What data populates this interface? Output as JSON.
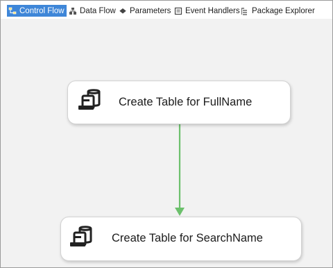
{
  "tabs": [
    {
      "label": "Control Flow",
      "icon": "control-flow-icon",
      "active": true
    },
    {
      "label": "Data Flow",
      "icon": "data-flow-icon",
      "active": false
    },
    {
      "label": "Parameters",
      "icon": "parameters-icon",
      "active": false
    },
    {
      "label": "Event Handlers",
      "icon": "event-handlers-icon",
      "active": false
    },
    {
      "label": "Package Explorer",
      "icon": "package-explorer-icon",
      "active": false
    }
  ],
  "tasks": [
    {
      "label": "Create Table for FullName",
      "icon": "sql-task-icon"
    },
    {
      "label": "Create Table for SearchName",
      "icon": "sql-task-icon"
    }
  ],
  "colors": {
    "active_tab": "#3e86d8",
    "connector": "#6cc06c",
    "canvas": "#f2f2f2"
  }
}
